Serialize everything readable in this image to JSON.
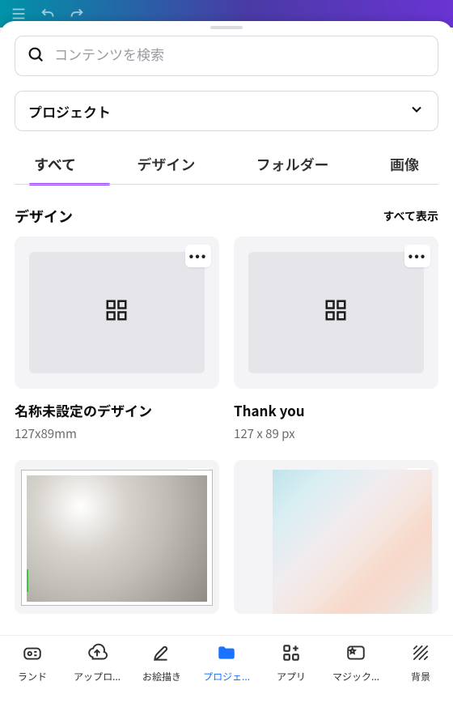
{
  "search": {
    "placeholder": "コンテンツを検索"
  },
  "selector": {
    "label": "プロジェクト"
  },
  "tabs": [
    "すべて",
    "デザイン",
    "フォルダー",
    "画像"
  ],
  "section": {
    "title": "デザイン",
    "see_all": "すべて表示"
  },
  "designs": [
    {
      "title": "名称未設定のデザイン",
      "subtitle": "127x89mm"
    },
    {
      "title": "Thank you",
      "subtitle": "127 x 89 px"
    }
  ],
  "more": "•••",
  "nav": [
    {
      "label": "ランド"
    },
    {
      "label": "アップロ..."
    },
    {
      "label": "お絵描き"
    },
    {
      "label": "プロジェ..."
    },
    {
      "label": "アプリ"
    },
    {
      "label": "マジック..."
    },
    {
      "label": "背景"
    }
  ]
}
